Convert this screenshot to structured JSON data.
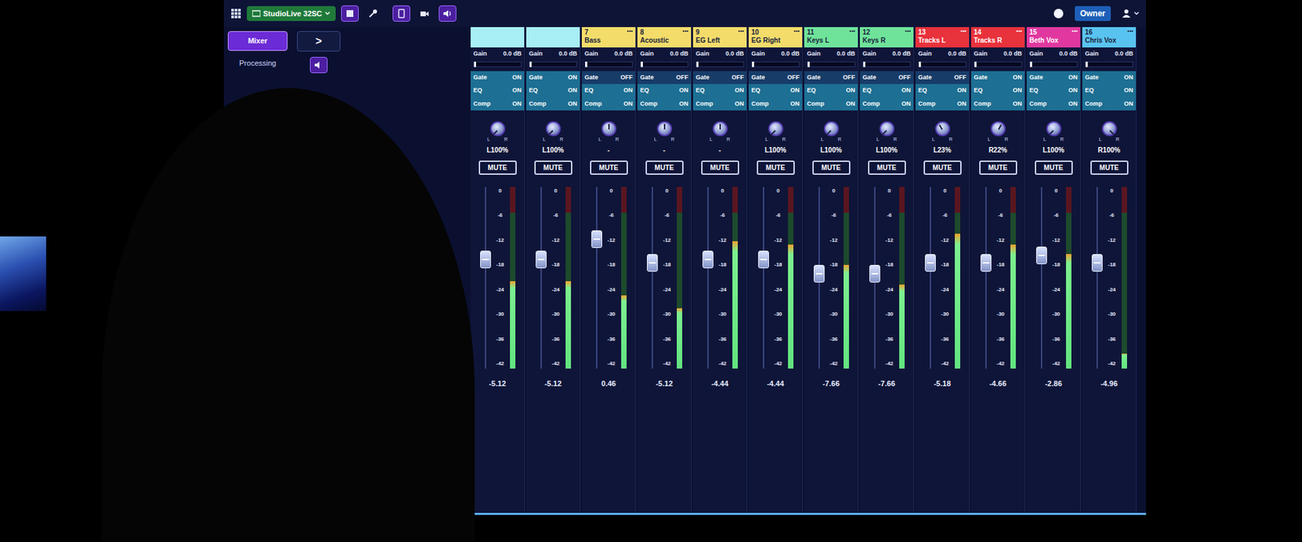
{
  "topbar": {
    "device": "StudioLive 32SC",
    "owner": "Owner"
  },
  "sidebar": {
    "tabs": [
      {
        "label": "Mixer",
        "selected": true
      },
      {
        "label": "Processing",
        "selected": false
      }
    ],
    "chevron": ">"
  },
  "fader_scale": [
    "0",
    "-6",
    "-12",
    "-18",
    "-24",
    "-30",
    "-36",
    "-42"
  ],
  "pan_marks": [
    "L",
    "R"
  ],
  "channels": [
    {
      "color": "#a8eef5",
      "gain_label": "Gain",
      "gain": "0.0 dB",
      "gain_level": 0,
      "processing": [
        {
          "label": "Gate",
          "state": "ON",
          "on": true
        },
        {
          "label": "EQ",
          "state": "ON",
          "on": true
        },
        {
          "label": "Comp",
          "state": "ON",
          "on": true
        }
      ],
      "pan": 0,
      "pan_reading": "L100%",
      "mute": "MUTE",
      "muted": false,
      "fader": 0.6,
      "meter": 0.48,
      "reading": "-5.12"
    },
    {
      "color": "#a8eef5",
      "gain_label": "Gain",
      "gain": "0.0 dB",
      "gain_level": 0,
      "processing": [
        {
          "label": "Gate",
          "state": "ON",
          "on": true
        },
        {
          "label": "EQ",
          "state": "ON",
          "on": true
        },
        {
          "label": "Comp",
          "state": "ON",
          "on": true
        }
      ],
      "pan": 0,
      "pan_reading": "L100%",
      "mute": "MUTE",
      "muted": false,
      "fader": 0.6,
      "meter": 0.48,
      "reading": "-5.12"
    },
    {
      "number": "7",
      "name": "Bass",
      "menu": "•••",
      "color": "#f3dc6a",
      "gain_label": "Gain",
      "gain": "0.0 dB",
      "gain_level": 0,
      "processing": [
        {
          "label": "Gate",
          "state": "OFF",
          "on": false
        },
        {
          "label": "EQ",
          "state": "ON",
          "on": true
        },
        {
          "label": "Comp",
          "state": "ON",
          "on": true
        }
      ],
      "pan": 0.5,
      "pan_reading": "-",
      "mute": "MUTE",
      "muted": false,
      "fader": 0.71,
      "meter": 0.4,
      "reading": "0.46"
    },
    {
      "number": "8",
      "name": "Acoustic",
      "menu": "•••",
      "color": "#f3dc6a",
      "gain_label": "Gain",
      "gain": "0.0 dB",
      "gain_level": 0,
      "processing": [
        {
          "label": "Gate",
          "state": "OFF",
          "on": false
        },
        {
          "label": "EQ",
          "state": "ON",
          "on": true
        },
        {
          "label": "Comp",
          "state": "ON",
          "on": true
        }
      ],
      "pan": 0.5,
      "pan_reading": "-",
      "mute": "MUTE",
      "muted": false,
      "fader": 0.58,
      "meter": 0.33,
      "reading": "-5.12"
    },
    {
      "number": "9",
      "name": "EG Left",
      "menu": "•••",
      "color": "#f3dc6a",
      "gain_label": "Gain",
      "gain": "0.0 dB",
      "gain_level": 0,
      "processing": [
        {
          "label": "Gate",
          "state": "OFF",
          "on": false
        },
        {
          "label": "EQ",
          "state": "ON",
          "on": true
        },
        {
          "label": "Comp",
          "state": "ON",
          "on": true
        }
      ],
      "pan": 0.5,
      "pan_reading": "-",
      "mute": "MUTE",
      "muted": false,
      "fader": 0.6,
      "meter": 0.7,
      "reading": "-4.44"
    },
    {
      "number": "10",
      "name": "EG Right",
      "menu": "•••",
      "color": "#f3dc6a",
      "gain_label": "Gain",
      "gain": "0.0 dB",
      "gain_level": 0,
      "processing": [
        {
          "label": "Gate",
          "state": "OFF",
          "on": false
        },
        {
          "label": "EQ",
          "state": "ON",
          "on": true
        },
        {
          "label": "Comp",
          "state": "ON",
          "on": true
        }
      ],
      "pan": 0,
      "pan_reading": "L100%",
      "mute": "MUTE",
      "muted": false,
      "fader": 0.6,
      "meter": 0.68,
      "reading": "-4.44"
    },
    {
      "number": "11",
      "name": "Keys L",
      "menu": "•••",
      "color": "#6fe39a",
      "gain_label": "Gain",
      "gain": "0.0 dB",
      "gain_level": 0,
      "processing": [
        {
          "label": "Gate",
          "state": "OFF",
          "on": false
        },
        {
          "label": "EQ",
          "state": "ON",
          "on": true
        },
        {
          "label": "Comp",
          "state": "ON",
          "on": true
        }
      ],
      "pan": 0,
      "pan_reading": "L100%",
      "mute": "MUTE",
      "muted": false,
      "fader": 0.52,
      "meter": 0.57,
      "reading": "-7.66"
    },
    {
      "number": "12",
      "name": "Keys R",
      "menu": "•••",
      "color": "#6fe39a",
      "gain_label": "Gain",
      "gain": "0.0 dB",
      "gain_level": 0,
      "processing": [
        {
          "label": "Gate",
          "state": "OFF",
          "on": false
        },
        {
          "label": "EQ",
          "state": "ON",
          "on": true
        },
        {
          "label": "Comp",
          "state": "ON",
          "on": true
        }
      ],
      "pan": 0,
      "pan_reading": "L100%",
      "mute": "MUTE",
      "muted": false,
      "fader": 0.52,
      "meter": 0.46,
      "reading": "-7.66"
    },
    {
      "number": "13",
      "name": "Tracks L",
      "menu": "•••",
      "color": "#e8323c",
      "gain_label": "Gain",
      "gain": "0.0 dB",
      "gain_level": 0,
      "processing": [
        {
          "label": "Gate",
          "state": "OFF",
          "on": false
        },
        {
          "label": "EQ",
          "state": "ON",
          "on": true
        },
        {
          "label": "Comp",
          "state": "ON",
          "on": true
        }
      ],
      "pan": 0.385,
      "pan_reading": "L23%",
      "mute": "MUTE",
      "muted": false,
      "fader": 0.58,
      "meter": 0.74,
      "reading": "-5.18"
    },
    {
      "number": "14",
      "name": "Tracks R",
      "menu": "•••",
      "color": "#e8323c",
      "gain_label": "Gain",
      "gain": "0.0 dB",
      "gain_level": 0,
      "processing": [
        {
          "label": "Gate",
          "state": "ON",
          "on": true
        },
        {
          "label": "EQ",
          "state": "ON",
          "on": true
        },
        {
          "label": "Comp",
          "state": "ON",
          "on": true
        }
      ],
      "pan": 0.61,
      "pan_reading": "R22%",
      "mute": "MUTE",
      "muted": false,
      "fader": 0.58,
      "meter": 0.68,
      "reading": "-4.66"
    },
    {
      "number": "15",
      "name": "Beth Vox",
      "menu": "•••",
      "color": "#e0389f",
      "gain_label": "Gain",
      "gain": "0.0 dB",
      "gain_level": 0,
      "processing": [
        {
          "label": "Gate",
          "state": "ON",
          "on": true
        },
        {
          "label": "EQ",
          "state": "ON",
          "on": true
        },
        {
          "label": "Comp",
          "state": "ON",
          "on": true
        }
      ],
      "pan": 0,
      "pan_reading": "L100%",
      "mute": "MUTE",
      "muted": false,
      "fader": 0.62,
      "meter": 0.63,
      "reading": "-2.86"
    },
    {
      "number": "16",
      "name": "Chris Vox",
      "menu": "•••",
      "color": "#59c3f0",
      "gain_label": "Gain",
      "gain": "0.0 dB",
      "gain_level": 0,
      "processing": [
        {
          "label": "Gate",
          "state": "ON",
          "on": true
        },
        {
          "label": "EQ",
          "state": "ON",
          "on": true
        },
        {
          "label": "Comp",
          "state": "ON",
          "on": true
        }
      ],
      "pan": 1,
      "pan_reading": "R100%",
      "mute": "MUTE",
      "muted": false,
      "fader": 0.58,
      "meter": 0.08,
      "reading": "-4.96"
    }
  ]
}
